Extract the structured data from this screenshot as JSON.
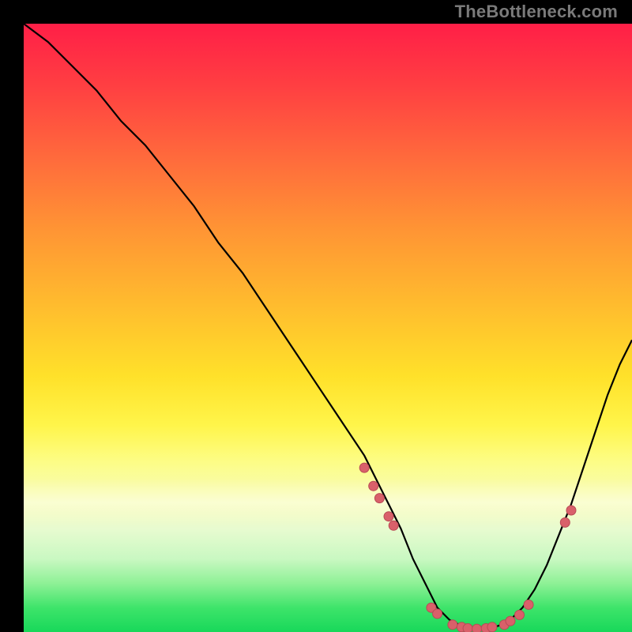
{
  "watermark": "TheBottleneck.com",
  "colors": {
    "curve_stroke": "#000000",
    "marker_fill": "#d9606a",
    "marker_stroke": "#b94a55",
    "background_black": "#000000"
  },
  "chart_data": {
    "type": "line",
    "title": "",
    "xlabel": "",
    "ylabel": "",
    "xlim": [
      0,
      100
    ],
    "ylim": [
      0,
      100
    ],
    "grid": false,
    "legend": false,
    "note": "Values are read from pixel positions; the image has no tick labels, so x/y are normalized 0–100 where y=0 is the bottom (green) and y=100 is the top (red).",
    "series": [
      {
        "name": "bottleneck-curve",
        "x": [
          0,
          4,
          8,
          12,
          16,
          20,
          24,
          28,
          32,
          36,
          40,
          44,
          48,
          52,
          56,
          58,
          60,
          62,
          64,
          66,
          68,
          70,
          72,
          74,
          76,
          78,
          80,
          82,
          84,
          86,
          88,
          90,
          92,
          94,
          96,
          98,
          100
        ],
        "y": [
          100,
          97,
          93,
          89,
          84,
          80,
          75,
          70,
          64,
          59,
          53,
          47,
          41,
          35,
          29,
          25,
          21,
          17,
          12,
          8,
          4,
          2,
          1,
          0.5,
          0.5,
          1,
          2,
          4,
          7,
          11,
          16,
          21,
          27,
          33,
          39,
          44,
          48
        ]
      }
    ],
    "markers": {
      "name": "highlight-dots",
      "x": [
        56.0,
        57.5,
        58.5,
        60.0,
        60.8,
        67.0,
        68.0,
        70.5,
        72.0,
        73.0,
        74.5,
        76.0,
        77.0,
        79.0,
        80.0,
        81.5,
        83.0,
        89.0,
        90.0
      ],
      "y": [
        27.0,
        24.0,
        22.0,
        19.0,
        17.5,
        4.0,
        3.0,
        1.2,
        0.8,
        0.6,
        0.5,
        0.6,
        0.8,
        1.2,
        1.8,
        2.8,
        4.5,
        18.0,
        20.0
      ]
    },
    "good_band_y_range": [
      15,
      24
    ]
  }
}
